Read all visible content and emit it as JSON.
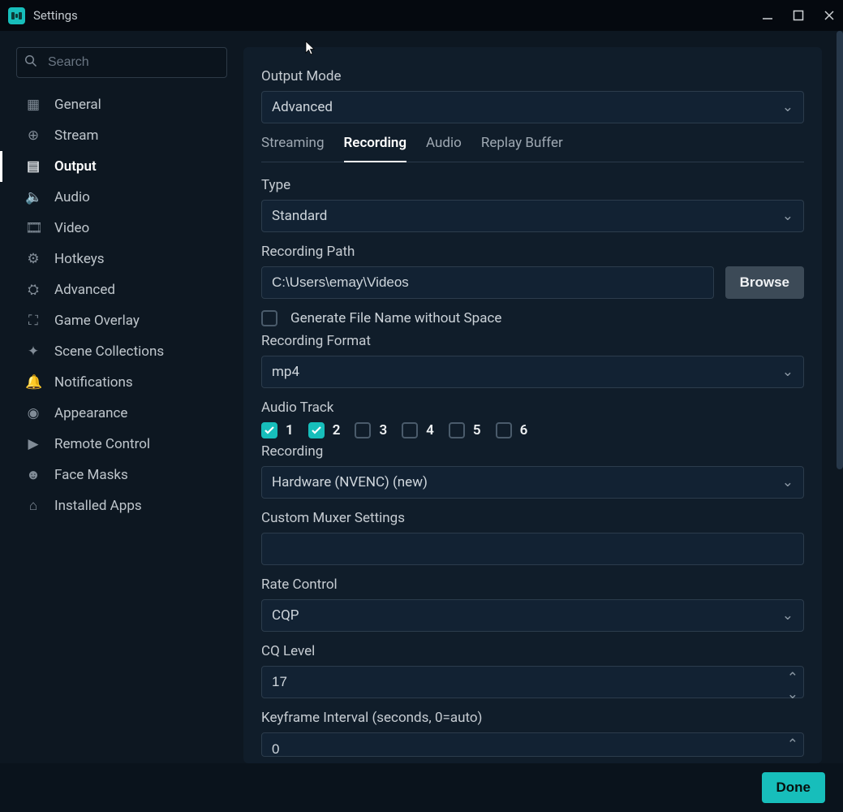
{
  "window": {
    "title": "Settings"
  },
  "search": {
    "placeholder": "Search"
  },
  "sidebar": {
    "items": [
      {
        "label": "General",
        "icon": "grid-icon"
      },
      {
        "label": "Stream",
        "icon": "globe-icon"
      },
      {
        "label": "Output",
        "icon": "chip-icon",
        "active": true
      },
      {
        "label": "Audio",
        "icon": "volume-icon"
      },
      {
        "label": "Video",
        "icon": "film-icon"
      },
      {
        "label": "Hotkeys",
        "icon": "gear-icon"
      },
      {
        "label": "Advanced",
        "icon": "gears-icon"
      },
      {
        "label": "Game Overlay",
        "icon": "overlay-icon"
      },
      {
        "label": "Scene Collections",
        "icon": "collections-icon"
      },
      {
        "label": "Notifications",
        "icon": "bell-icon"
      },
      {
        "label": "Appearance",
        "icon": "palette-icon"
      },
      {
        "label": "Remote Control",
        "icon": "play-icon"
      },
      {
        "label": "Face Masks",
        "icon": "mask-icon"
      },
      {
        "label": "Installed Apps",
        "icon": "apps-icon"
      }
    ]
  },
  "main": {
    "output_mode_label": "Output Mode",
    "output_mode_value": "Advanced",
    "tabs": [
      {
        "label": "Streaming"
      },
      {
        "label": "Recording",
        "active": true
      },
      {
        "label": "Audio"
      },
      {
        "label": "Replay Buffer"
      }
    ],
    "type_label": "Type",
    "type_value": "Standard",
    "recpath_label": "Recording Path",
    "recpath_value": "C:\\Users\\emay\\Videos",
    "browse_label": "Browse",
    "genfilename_label": "Generate File Name without Space",
    "genfilename_checked": false,
    "recformat_label": "Recording Format",
    "recformat_value": "mp4",
    "audiotrack_label": "Audio Track",
    "audiotrack": [
      {
        "n": "1",
        "on": true
      },
      {
        "n": "2",
        "on": true
      },
      {
        "n": "3",
        "on": false
      },
      {
        "n": "4",
        "on": false
      },
      {
        "n": "5",
        "on": false
      },
      {
        "n": "6",
        "on": false
      }
    ],
    "recording_label": "Recording",
    "recording_value": "Hardware (NVENC) (new)",
    "muxer_label": "Custom Muxer Settings",
    "muxer_value": "",
    "rate_label": "Rate Control",
    "rate_value": "CQP",
    "cq_label": "CQ Level",
    "cq_value": "17",
    "keyframe_label": "Keyframe Interval (seconds, 0=auto)",
    "keyframe_value": "0"
  },
  "footer": {
    "done": "Done"
  },
  "icons": {
    "grid-icon": "▦",
    "globe-icon": "⊕",
    "chip-icon": "▤",
    "volume-icon": "🔈",
    "film-icon": "🎞",
    "gear-icon": "⚙",
    "gears-icon": "⛭",
    "overlay-icon": "⛶",
    "collections-icon": "✦",
    "bell-icon": "🔔",
    "palette-icon": "◉",
    "play-icon": "▶",
    "mask-icon": "☻",
    "apps-icon": "⌂"
  }
}
